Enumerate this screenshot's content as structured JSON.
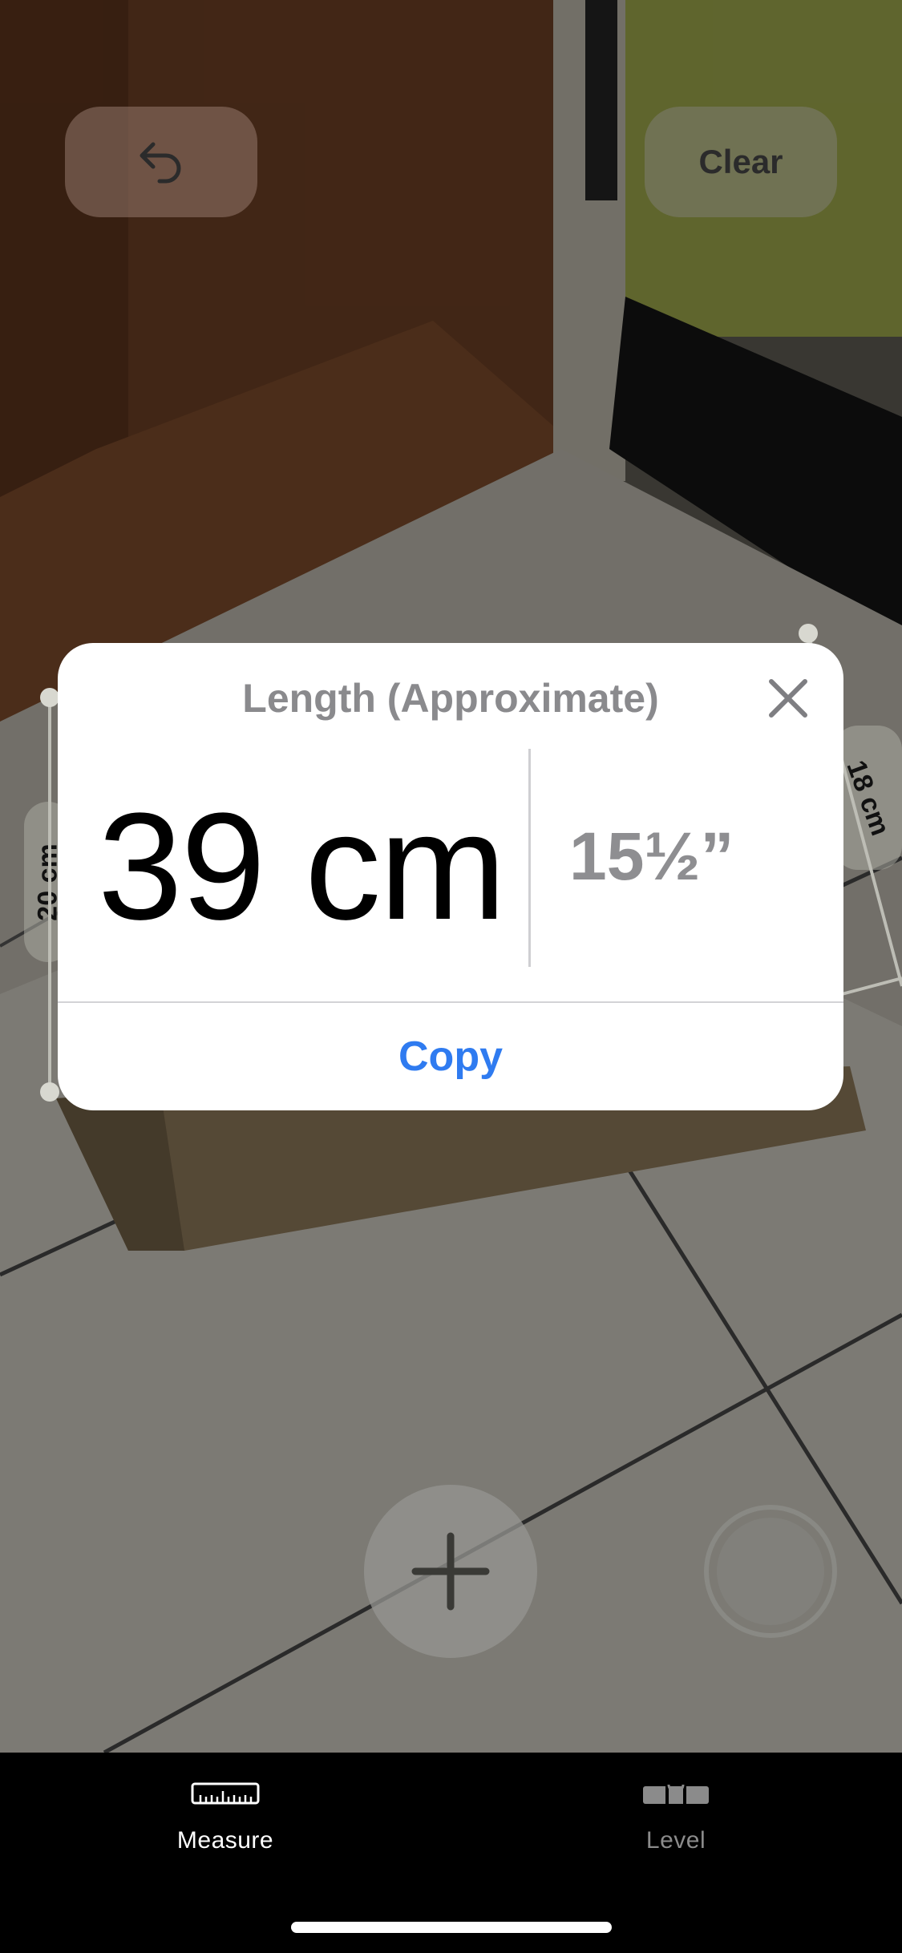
{
  "toolbar": {
    "undo_icon": "undo-arrow-icon",
    "clear_label": "Clear"
  },
  "edge_tags": {
    "left": "20 cm",
    "right": "18 cm"
  },
  "dialog": {
    "title": "Length (Approximate)",
    "primary_value": "39 cm",
    "secondary_value": "15½”",
    "copy_label": "Copy",
    "close_icon": "close-icon"
  },
  "controls": {
    "add_icon": "plus-icon",
    "capture_icon": "shutter-icon"
  },
  "tabs": [
    {
      "label": "Measure",
      "icon": "ruler-icon",
      "selected": true
    },
    {
      "label": "Level",
      "icon": "level-icon",
      "selected": false
    }
  ],
  "colors": {
    "accent": "#2f7bf0",
    "inactive_tab": "#8b8b8b"
  }
}
